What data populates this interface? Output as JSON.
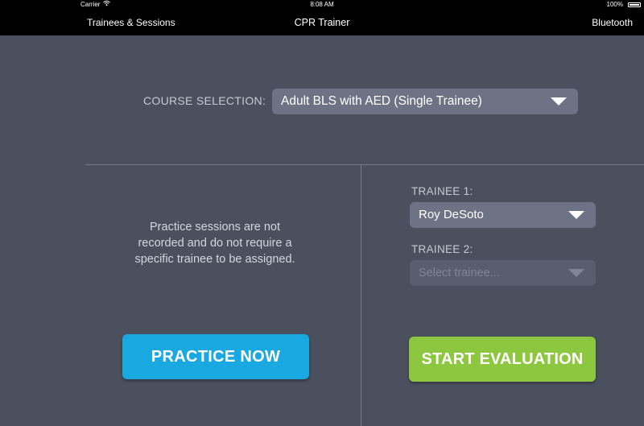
{
  "status_bar": {
    "carrier": "Carrier",
    "time": "8:08 AM",
    "battery": "100%",
    "wifi_icon": "wifi-icon",
    "battery_icon": "battery-icon"
  },
  "nav_bar": {
    "left_label": "Trainees & Sessions",
    "title": "CPR Trainer",
    "right_label": "Bluetooth"
  },
  "course": {
    "label": "COURSE SELECTION:",
    "selected": "Adult BLS with AED (Single Trainee)",
    "caret_icon": "caret-down-icon"
  },
  "practice": {
    "note": "Practice sessions are not recorded and do not require a specific trainee to be assigned.",
    "button_label": "PRACTICE NOW",
    "button_color": "#1aa8e0"
  },
  "evaluation": {
    "trainee1_label": "TRAINEE 1:",
    "trainee1_value": "Roy DeSoto",
    "trainee2_label": "TRAINEE 2:",
    "trainee2_placeholder": "Select trainee...",
    "button_label": "START EVALUATION",
    "button_color": "#8dc63f"
  },
  "colors": {
    "background": "#4a505e",
    "bars": "#000000",
    "dropdown": "#6d7385"
  }
}
